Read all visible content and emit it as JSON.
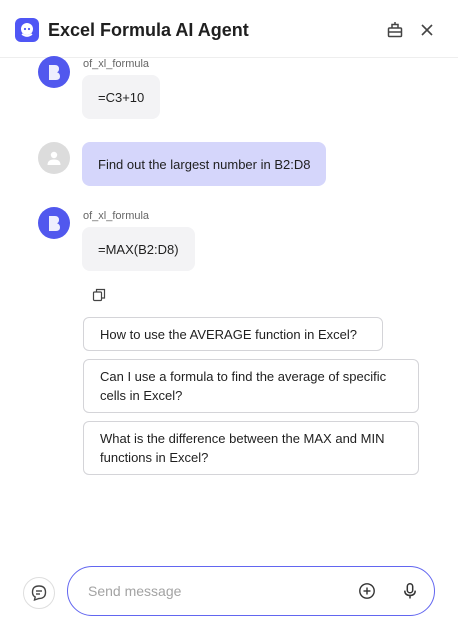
{
  "header": {
    "title": "Excel Formula AI Agent",
    "logo_icon": "bot-face-icon",
    "pin_icon": "pin-icon",
    "close_icon": "close-icon"
  },
  "colors": {
    "accent": "#5158ee",
    "user_bubble": "#d5d6fb",
    "bot_bubble": "#f3f3f5"
  },
  "messages": [
    {
      "role": "bot",
      "sender": "of_xl_formula",
      "text": "=C3+10"
    },
    {
      "role": "user",
      "sender": "",
      "text": "Find out the largest number in B2:D8"
    },
    {
      "role": "bot",
      "sender": "of_xl_formula",
      "text": "=MAX(B2:D8)"
    }
  ],
  "copy_icon": "copy-icon",
  "suggestions": [
    "How to use the AVERAGE function in Excel?",
    "Can I use a formula to find the average of specific cells in Excel?",
    "What is the difference between the MAX and MIN functions in Excel?"
  ],
  "footer": {
    "new_chat_icon": "new-chat-icon",
    "input": {
      "placeholder": "Send message",
      "value": ""
    },
    "add_icon": "plus-circle-icon",
    "mic_icon": "microphone-icon"
  }
}
